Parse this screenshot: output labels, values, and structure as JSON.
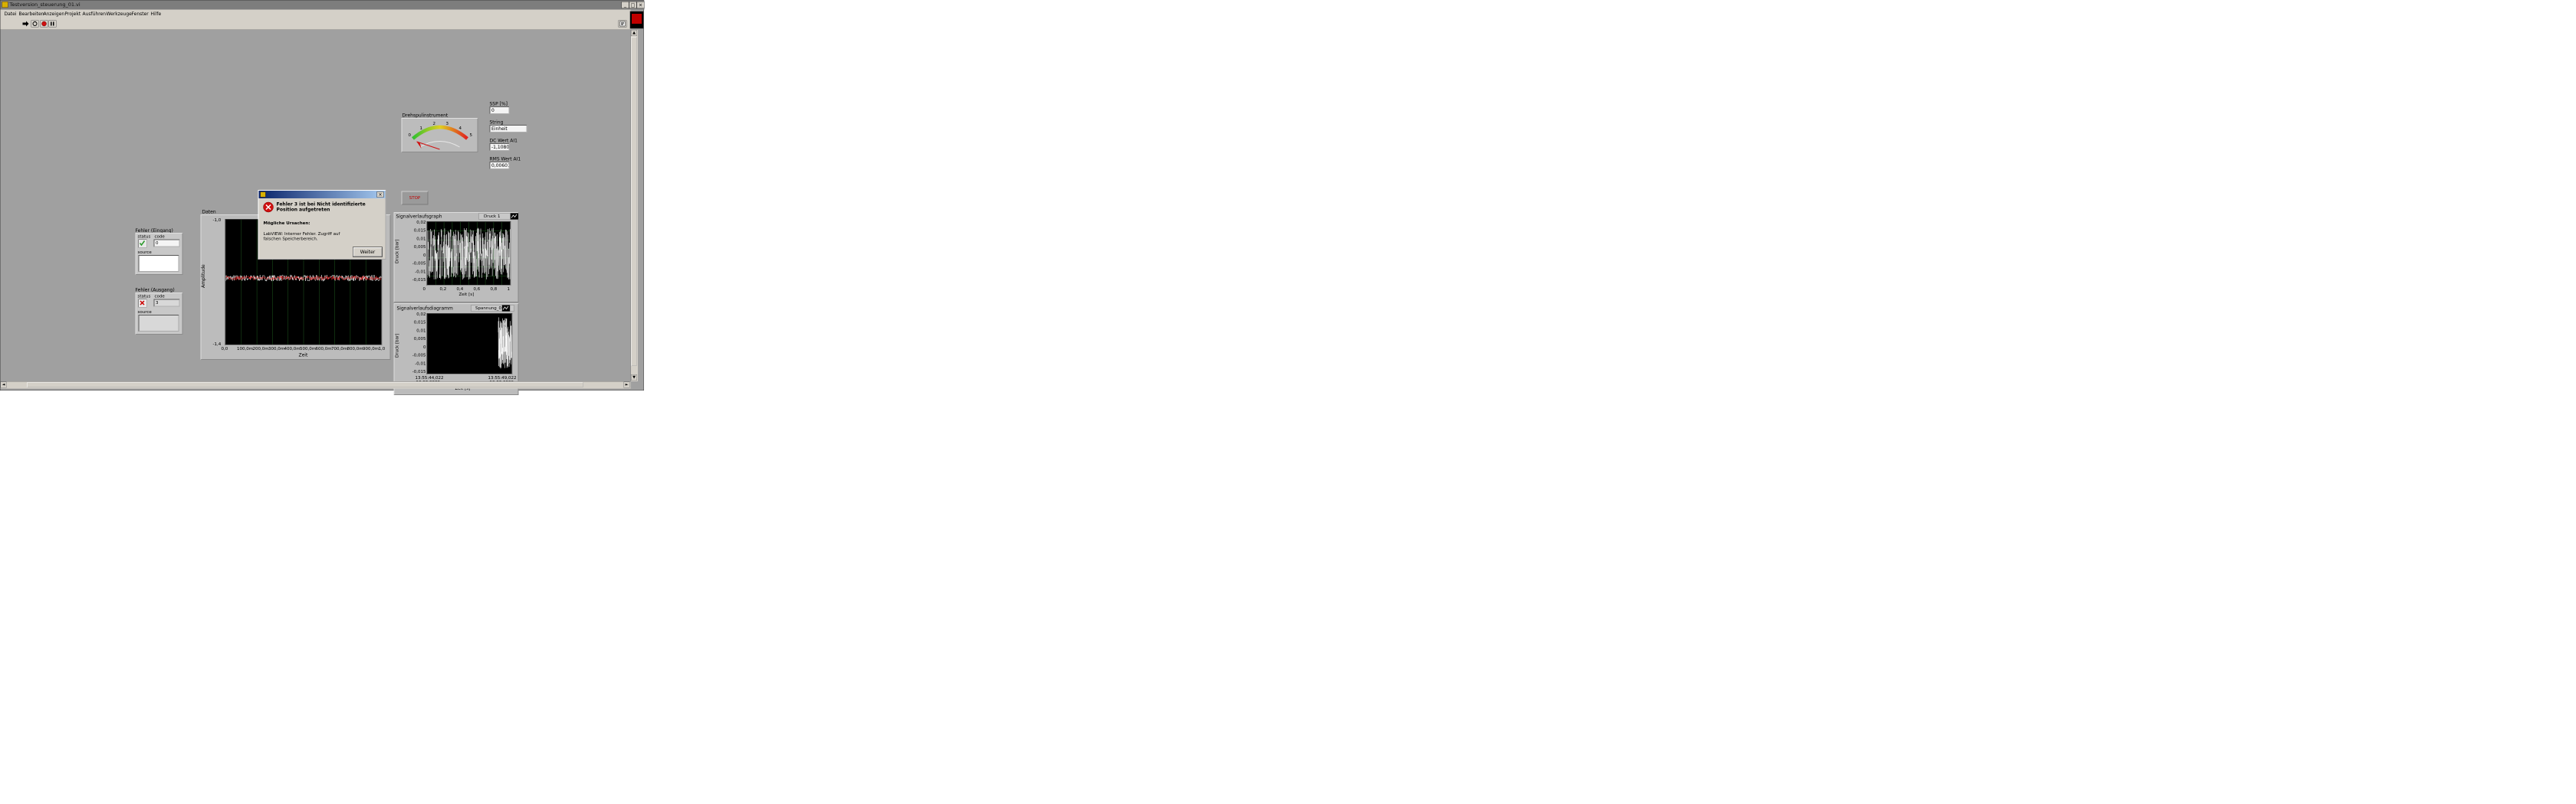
{
  "window": {
    "title": "Testversion_steuerung_01.vi",
    "controls": {
      "minimize": "_",
      "maximize": "□",
      "close": "×"
    }
  },
  "menubar": [
    "Datei",
    "Bearbeiten",
    "Anzeigen",
    "Projekt",
    "Ausführen",
    "Werkzeuge",
    "Fenster",
    "Hilfe"
  ],
  "toolbar": {
    "run": "run-arrow-icon",
    "run_continuously": "run-continuously-icon",
    "abort": "abort-stop-icon",
    "pause": "pause-icon"
  },
  "gauge": {
    "label": "Drehspulinstrument",
    "scale": [
      "0",
      "1",
      "2",
      "3",
      "4",
      "5"
    ]
  },
  "indicators": {
    "ssp": {
      "label": "SSP [%]",
      "value": "0"
    },
    "string": {
      "label": "String",
      "value": "Einheit"
    },
    "dc": {
      "label": "DC Wert AI1",
      "value": "-1,10801"
    },
    "rms": {
      "label": "RMS Wert AI1",
      "value": "0,00601("
    }
  },
  "stop_button": {
    "label": "STOP"
  },
  "dialog": {
    "heading": "Fehler 3 ist bei Nicht identifizierte Position aufgetreten",
    "causes_title": "Mögliche Ursachen:",
    "causes_text": "LabVIEW:  Interner Fehler. Zugriff auf falschen Speicherbereich.",
    "button": "Weiter"
  },
  "error_in": {
    "label": "Fehler (Eingang)",
    "status_label": "status",
    "code_label": "code",
    "code_value": "0",
    "source_label": "source",
    "status_value": "ok",
    "status_color": "#2a9a2a"
  },
  "error_out": {
    "label": "Fehler (Ausgang)",
    "status_label": "status",
    "code_label": "code",
    "code_value": "3",
    "source_label": "source",
    "status_value": "error",
    "status_color": "#cc0000"
  },
  "chart_data": [
    {
      "type": "line",
      "title": "Daten",
      "xlabel": "Zeit",
      "ylabel": "Amplitude",
      "xlim": [
        0,
        1
      ],
      "ylim": [
        -1.4,
        1.0
      ],
      "x_ticks": [
        "0,0",
        "100,0m",
        "200,0m",
        "300,0m",
        "400,0m",
        "500,0m",
        "600,0m",
        "700,0m",
        "800,0m",
        "900,0m",
        "1,0"
      ],
      "y_ticks": [
        "-1,0",
        "-1,4"
      ],
      "series": [
        {
          "values_mean": -0.12,
          "noise_amplitude": 0.06,
          "color": "#ffffff"
        },
        {
          "values_mean": -0.12,
          "noise_amplitude": 0.04,
          "color": "#e02020"
        }
      ],
      "grid": true,
      "grid_color": "#1f5a1f"
    },
    {
      "type": "line",
      "title": "Signalverlaufsgraph",
      "legend": "Druck 1",
      "xlabel": "Zeit [s]",
      "ylabel": "Druck [bar]",
      "xlim": [
        0,
        1
      ],
      "ylim": [
        -0.015,
        0.02
      ],
      "x_ticks": [
        "0",
        "0,2",
        "0,4",
        "0,6",
        "0,8",
        "1"
      ],
      "y_ticks": [
        "0,02",
        "0,015",
        "0,01",
        "0,005",
        "0",
        "-0,005",
        "-0,01",
        "-0,015"
      ],
      "noise_range": [
        -0.012,
        0.017
      ],
      "color": "#ffffff",
      "grid": true,
      "grid_color": "#1f5a1f"
    },
    {
      "type": "line",
      "title": "Signalverlaufsdiagramm",
      "legend": "Spannung_0",
      "xlabel": "Zeit [s]",
      "ylabel": "Druck [bar]",
      "ylim": [
        -0.015,
        0.02
      ],
      "x_ticks": [
        {
          "time": "13:55:44,022",
          "date": "10.03.2009"
        },
        {
          "time": "13:55:49,022",
          "date": "10.03.2009"
        }
      ],
      "y_ticks": [
        "0,02",
        "0,015",
        "0,01",
        "0,005",
        "0",
        "-0,005",
        "-0,01",
        "-0,015"
      ],
      "data_span": [
        0.84,
        1.0
      ],
      "noise_range": [
        -0.012,
        0.018
      ],
      "color": "#ffffff",
      "grid": false
    }
  ]
}
